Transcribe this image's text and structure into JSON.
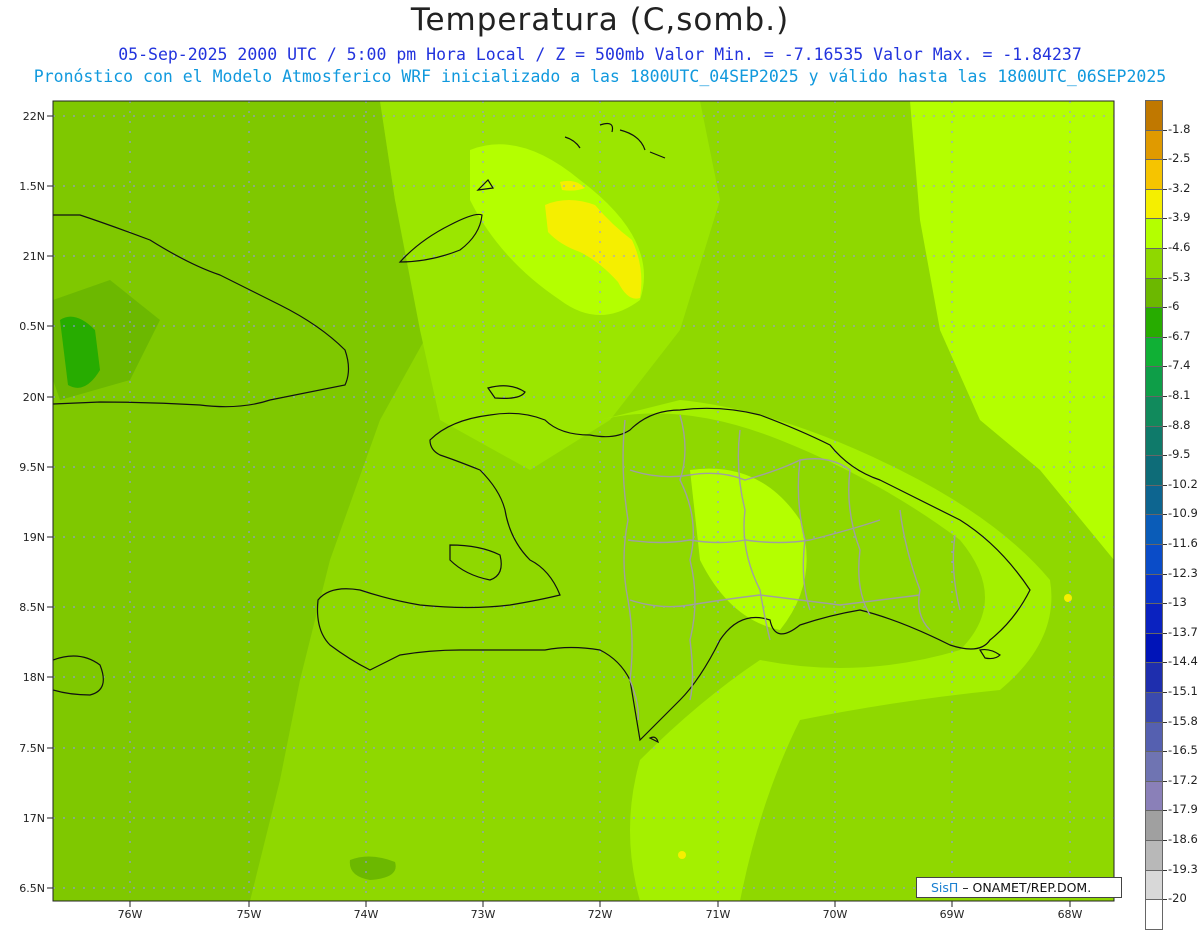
{
  "title": "Temperatura (C,somb.)",
  "subtitle_line1": "05-Sep-2025  2000 UTC / 5:00 pm Hora Local / Z = 500mb  Valor Min. = -7.16535  Valor Max. = -1.84237",
  "subtitle_line2": "Pronóstico con el Modelo Atmosferico WRF inicializado a las 1800UTC_04SEP2025 y válido hasta las  1800UTC_06SEP2025",
  "lat_labels": [
    "22N",
    "1.5N",
    "21N",
    "0.5N",
    "20N",
    "9.5N",
    "19N",
    "8.5N",
    "18N",
    "7.5N",
    "17N",
    "6.5N"
  ],
  "lon_labels": [
    "76W",
    "75W",
    "74W",
    "73W",
    "72W",
    "71W",
    "70W",
    "69W",
    "68W"
  ],
  "colorbar": {
    "labels": [
      "-1.8",
      "-2.5",
      "-3.2",
      "-3.9",
      "-4.6",
      "-5.3",
      "-6",
      "-6.7",
      "-7.4",
      "-8.1",
      "-8.8",
      "-9.5",
      "-10.2",
      "-10.9",
      "-11.6",
      "-12.3",
      "-13",
      "-13.7",
      "-14.4",
      "-15.1",
      "-15.8",
      "-16.5",
      "-17.2",
      "-17.9",
      "-18.6",
      "-19.3",
      "-20"
    ],
    "colors": [
      "#c07800",
      "#e09a00",
      "#f6c400",
      "#f5ef00",
      "#b4ff00",
      "#8fd800",
      "#6cb800",
      "#27ac00",
      "#10b035",
      "#0e9e48",
      "#118a5c",
      "#0f7a6a",
      "#0e6c78",
      "#0d6590",
      "#0a5cb8",
      "#0a4cc8",
      "#0a35c8",
      "#0a22c0",
      "#0014b8",
      "#1e2eae",
      "#3a4aae",
      "#5560b0",
      "#6f74b2",
      "#8a80b8",
      "#a0a0a0",
      "#b8b8b8",
      "#d8d8d8",
      "#ffffff"
    ]
  },
  "credit": {
    "brand": "SisΠ",
    "text": "– ONAMET/REP.DOM."
  },
  "colors": {
    "field_base": "#8fd800",
    "field_warm": "#b4ff00",
    "field_cool": "#6cb800",
    "field_hot": "#f5ef00",
    "coast": "#111111",
    "provinces": "#a0a0a0",
    "grid": "#9090ff"
  }
}
